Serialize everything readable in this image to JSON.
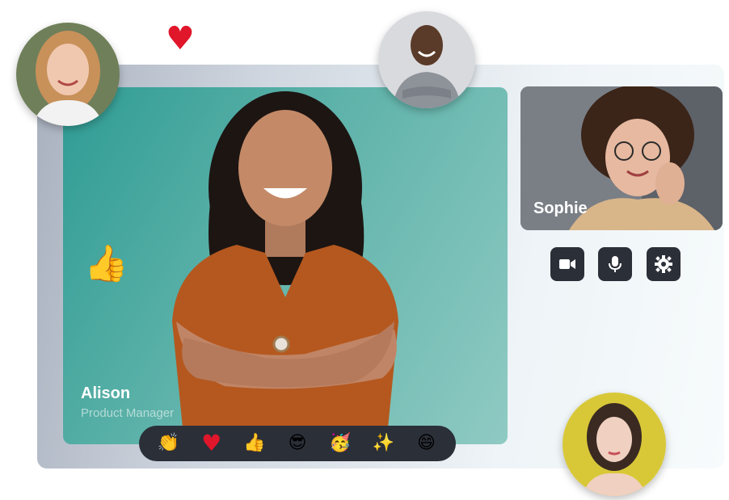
{
  "main_video": {
    "participant_name": "Alison",
    "participant_role": "Product Manager"
  },
  "side_video": {
    "participant_name": "Sophie"
  },
  "controls": [
    {
      "icon": "video-camera-icon"
    },
    {
      "icon": "microphone-icon"
    },
    {
      "icon": "settings-gear-icon"
    }
  ],
  "reactions": {
    "clap": "👏",
    "heart": "♥",
    "thumbs_up": "👍",
    "cool": "😎",
    "party": "🥳",
    "sparkle": "✨",
    "laugh": "😄"
  },
  "floating_reactions": {
    "heart": "♥",
    "thumbs_up": "👍"
  },
  "colors": {
    "accent_teal": "#3aa59b",
    "dark_ui": "#2b2f38",
    "heart_red": "#e0162b"
  }
}
